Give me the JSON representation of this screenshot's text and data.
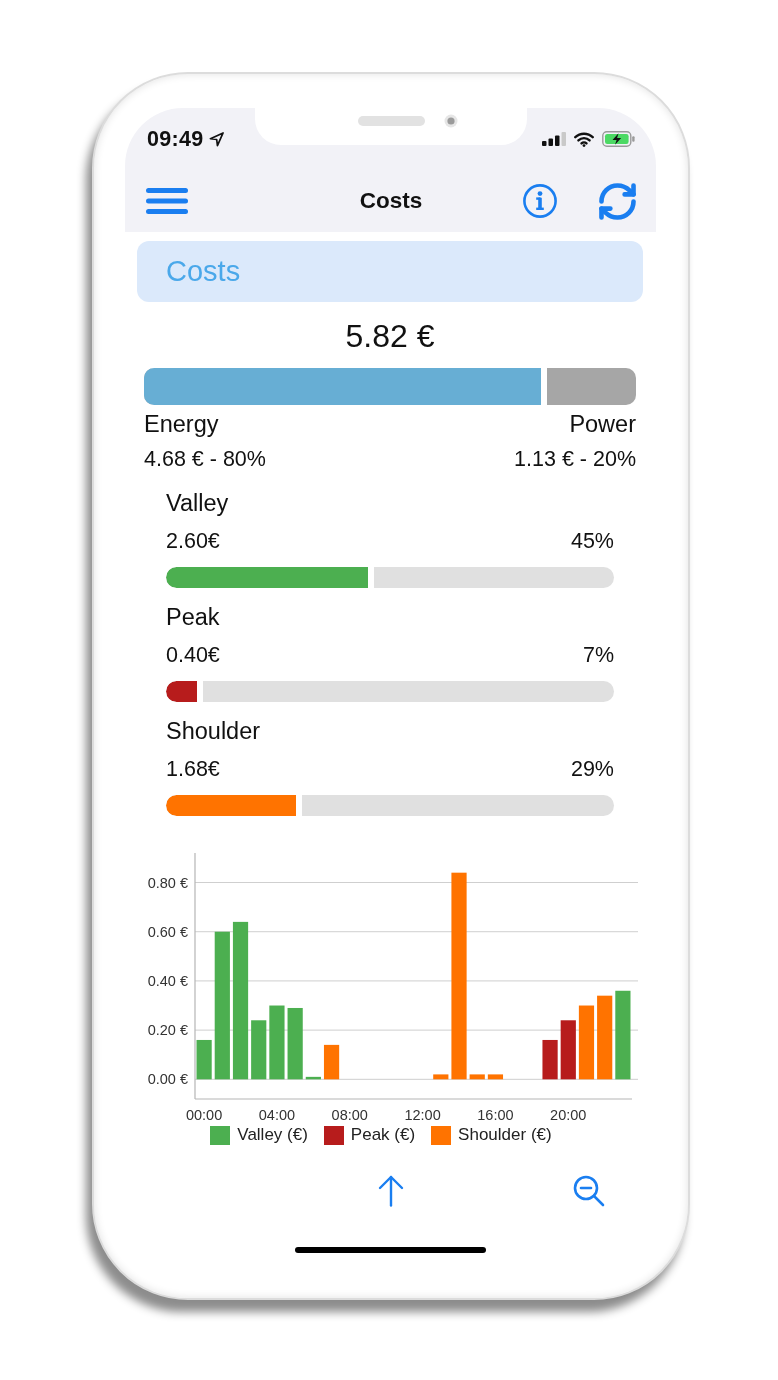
{
  "status_bar": {
    "time": "09:49"
  },
  "nav_bar": {
    "title": "Costs"
  },
  "section_header": {
    "title": "Costs"
  },
  "total": "5.82 €",
  "split": {
    "level": 0.806,
    "parts": [
      {
        "label": "Energy",
        "reading": "4.68 € - 80%"
      },
      {
        "label": "Power",
        "reading": "1.13 € - 20%"
      }
    ]
  },
  "periods": [
    {
      "name": "Valley",
      "amount": "2.60€",
      "share": "45%",
      "level": 0.45,
      "color": "#4caf50"
    },
    {
      "name": "Peak",
      "amount": "0.40€",
      "share": "7%",
      "level": 0.07,
      "color": "#b71c1c"
    },
    {
      "name": "Shoulder",
      "amount": "1.68€",
      "share": "29%",
      "level": 0.29,
      "color": "#ff7300"
    }
  ],
  "chart": {
    "chart_data": {
      "type": "bar",
      "stacked": true,
      "grid": true,
      "legend": "bottom",
      "x": [
        0,
        1,
        2,
        3,
        4,
        5,
        6,
        7,
        8,
        9,
        10,
        11,
        12,
        13,
        14,
        15,
        16,
        17,
        18,
        19,
        20,
        21,
        22,
        23
      ],
      "xlim": [
        -0.5,
        23.5
      ],
      "xticks": [
        {
          "value": 0,
          "label": "00:00"
        },
        {
          "value": 4,
          "label": "04:00"
        },
        {
          "value": 8,
          "label": "08:00"
        },
        {
          "value": 12,
          "label": "12:00"
        },
        {
          "value": 16,
          "label": "16:00"
        },
        {
          "value": 20,
          "label": "20:00"
        }
      ],
      "ylim": [
        -0.08,
        0.92
      ],
      "yticks": [
        {
          "value": 0,
          "label": "0.00 €"
        },
        {
          "value": 0.2,
          "label": "0.20 €"
        },
        {
          "value": 0.4,
          "label": "0.40 €"
        },
        {
          "value": 0.6,
          "label": "0.60 €"
        },
        {
          "value": 0.8,
          "label": "0.80 €"
        }
      ],
      "series": [
        {
          "name": "Valley (€)",
          "color": "#4caf50",
          "values": [
            0.16,
            0.6,
            0.64,
            0.24,
            0.3,
            0.29,
            0.01,
            null,
            null,
            null,
            null,
            null,
            null,
            null,
            null,
            null,
            null,
            null,
            null,
            null,
            null,
            null,
            null,
            0.36
          ]
        },
        {
          "name": "Peak (€)",
          "color": "#b71c1c",
          "values": [
            null,
            null,
            null,
            null,
            null,
            null,
            null,
            null,
            null,
            null,
            null,
            null,
            null,
            null,
            null,
            null,
            null,
            null,
            null,
            0.16,
            0.24,
            null,
            null,
            null
          ]
        },
        {
          "name": "Shoulder (€)",
          "color": "#ff7300",
          "values": [
            null,
            null,
            null,
            null,
            null,
            null,
            null,
            0.14,
            null,
            null,
            null,
            null,
            null,
            0.02,
            0.84,
            0.02,
            0.02,
            null,
            null,
            null,
            null,
            0.3,
            0.34,
            null
          ]
        }
      ]
    }
  }
}
